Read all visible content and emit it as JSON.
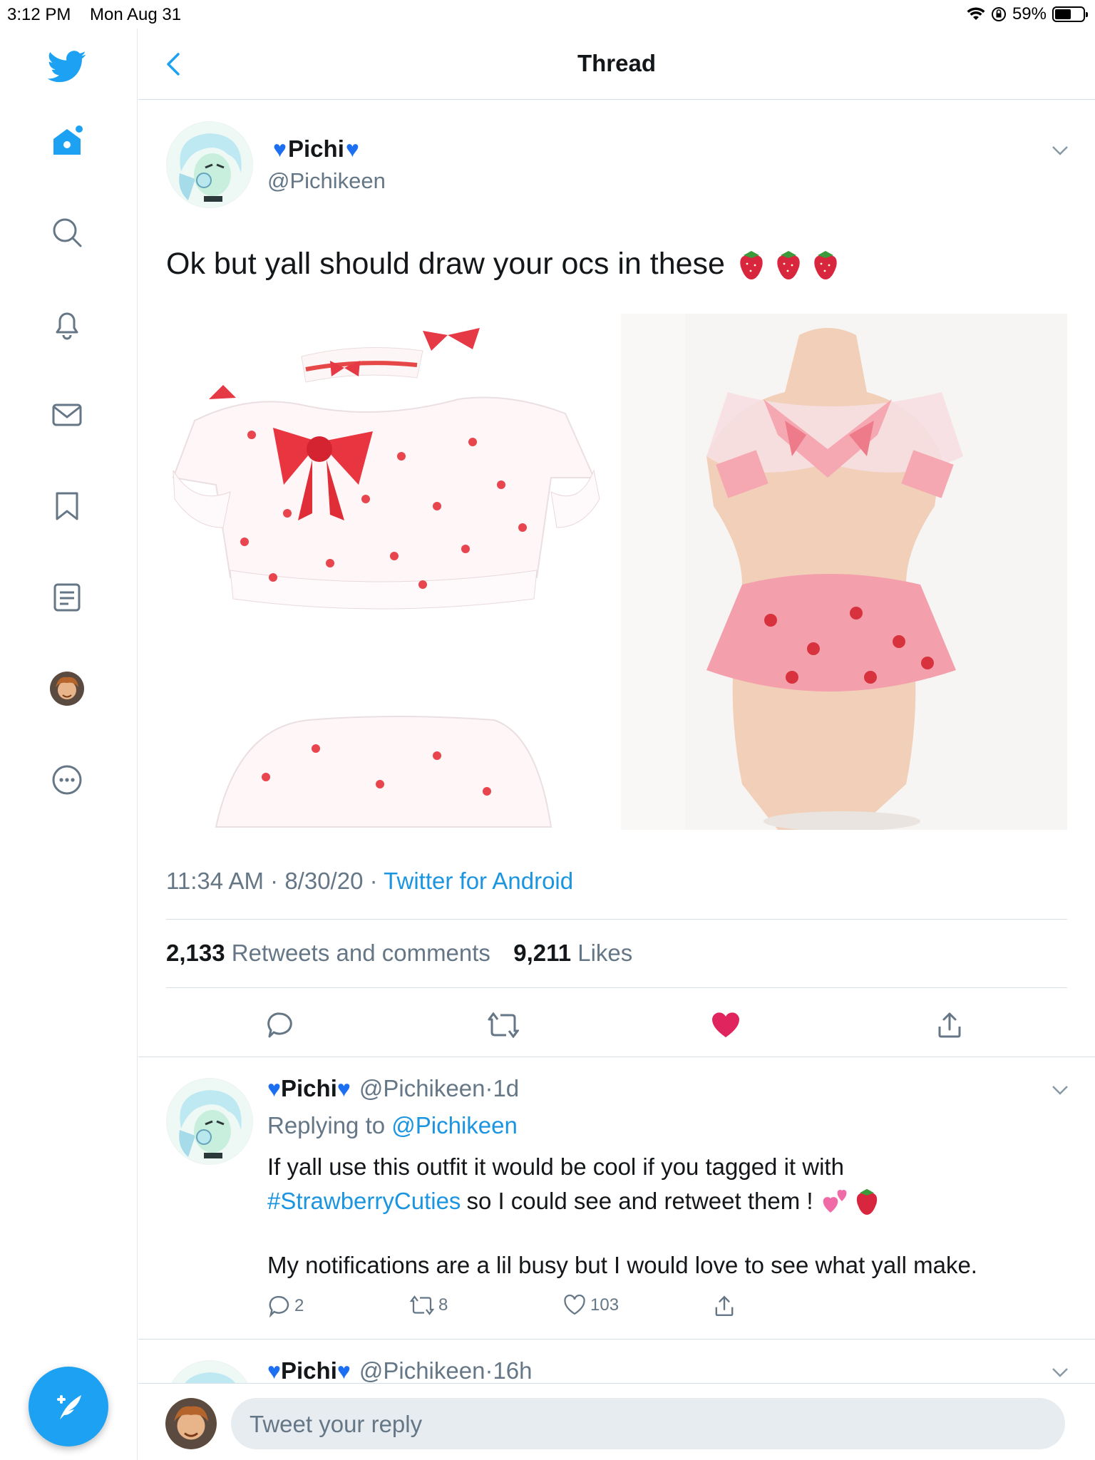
{
  "status_bar": {
    "time": "3:12 PM",
    "date": "Mon Aug 31",
    "battery": "59%",
    "battery_level": 0.59
  },
  "header": {
    "title": "Thread"
  },
  "main_tweet": {
    "name": "Pichi",
    "handle": "@Pichikeen",
    "text": "Ok but yall should draw your ocs in these",
    "time": "11:34 AM",
    "date": "8/30/20",
    "source": "Twitter for Android",
    "retweets_count": "2,133",
    "retweets_label": "Retweets and comments",
    "likes_count": "9,211",
    "likes_label": "Likes",
    "liked": true
  },
  "replies": [
    {
      "name": "Pichi",
      "handle": "@Pichikeen",
      "age": "1d",
      "replying_label": "Replying to",
      "replying_to": "@Pichikeen",
      "text_line1": "If yall use this outfit it would be cool if you tagged it with",
      "hashtag": "#StrawberryCuties",
      "text_line2_rest": "so I could see and retweet them !",
      "text_line3": "My notifications are a lil busy but I would love to see what yall make.",
      "replies_count": "2",
      "retweets_count": "8",
      "likes_count": "103"
    },
    {
      "name": "Pichi",
      "handle": "@Pichikeen",
      "age": "16h"
    }
  ],
  "reply_bar": {
    "placeholder": "Tweet your reply"
  },
  "colors": {
    "accent": "#1da1f2",
    "like": "#e0245e",
    "text": "#14171a",
    "secondary": "#657786"
  }
}
